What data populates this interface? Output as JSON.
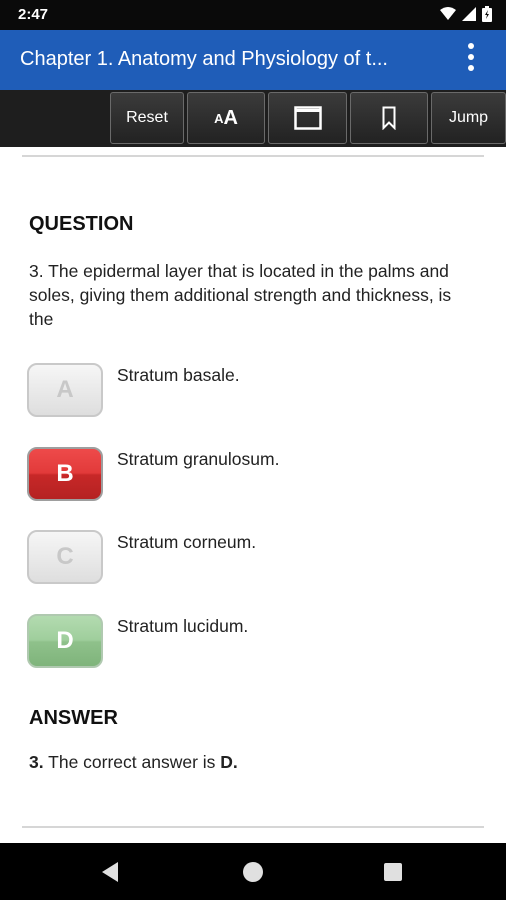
{
  "status_bar": {
    "time": "2:47"
  },
  "app_bar": {
    "title": "Chapter 1. Anatomy and Physiology of t..."
  },
  "toolbar": {
    "reset_label": "Reset",
    "font_small": "A",
    "font_big": "A",
    "jump_label": "Jump"
  },
  "question": {
    "heading": "QUESTION",
    "text": "3. The epidermal layer that is located in the palms and soles, giving them additional strength and thickness, is the",
    "options": [
      {
        "letter": "A",
        "text": "Stratum basale.",
        "state": "disabled"
      },
      {
        "letter": "B",
        "text": "Stratum granulosum.",
        "state": "wrong"
      },
      {
        "letter": "C",
        "text": "Stratum corneum.",
        "state": "disabled"
      },
      {
        "letter": "D",
        "text": "Stratum lucidum.",
        "state": "correct"
      }
    ]
  },
  "answer": {
    "heading": "ANSWER",
    "number": "3.",
    "text": " The correct answer is ",
    "letter": "D."
  },
  "colors": {
    "app_bar": "#1f5db8",
    "wrong": "#e23a3a",
    "correct": "#9fce9c"
  },
  "icons": [
    "wifi-icon",
    "signal-icon",
    "battery-icon",
    "more-vert-icon",
    "window-icon",
    "bookmark-icon",
    "back-icon",
    "home-icon",
    "recents-icon"
  ]
}
